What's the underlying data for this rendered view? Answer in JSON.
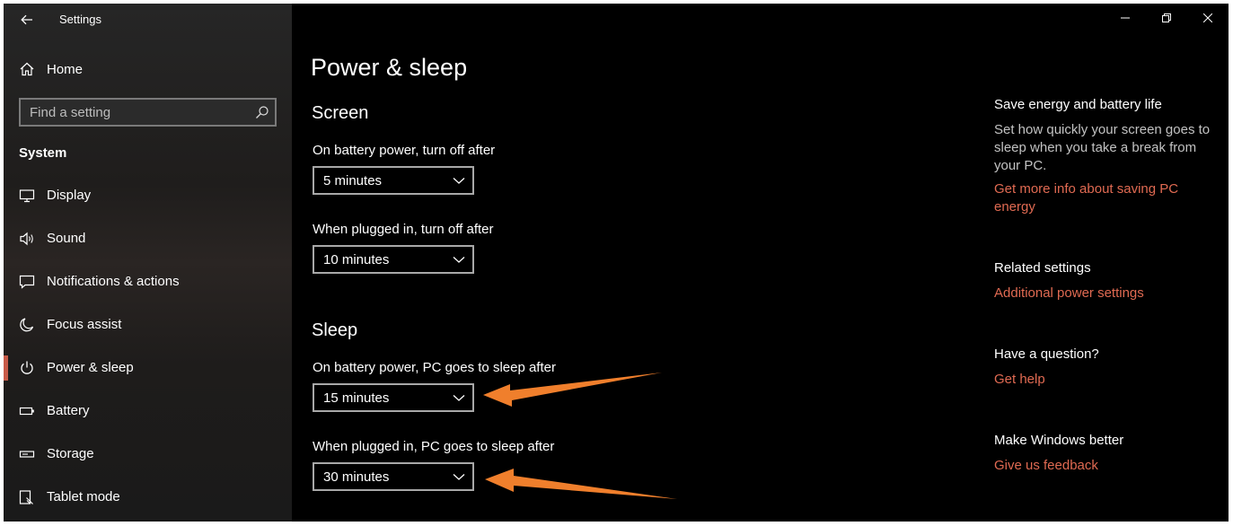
{
  "app": {
    "title": "Settings"
  },
  "sidebar": {
    "home_label": "Home",
    "search_placeholder": "Find a setting",
    "section_title": "System",
    "items": [
      {
        "label": "Display",
        "icon": "monitor-icon"
      },
      {
        "label": "Sound",
        "icon": "speaker-icon"
      },
      {
        "label": "Notifications & actions",
        "icon": "notification-icon"
      },
      {
        "label": "Focus assist",
        "icon": "moon-icon"
      },
      {
        "label": "Power & sleep",
        "icon": "power-icon",
        "active": true
      },
      {
        "label": "Battery",
        "icon": "battery-icon"
      },
      {
        "label": "Storage",
        "icon": "storage-icon"
      },
      {
        "label": "Tablet mode",
        "icon": "tablet-mode-icon"
      }
    ]
  },
  "main": {
    "title": "Power & sleep",
    "screen": {
      "title": "Screen",
      "battery_label": "On battery power, turn off after",
      "battery_value": "5 minutes",
      "plugged_label": "When plugged in, turn off after",
      "plugged_value": "10 minutes"
    },
    "sleep": {
      "title": "Sleep",
      "battery_label": "On battery power, PC goes to sleep after",
      "battery_value": "15 minutes",
      "plugged_label": "When plugged in, PC goes to sleep after",
      "plugged_value": "30 minutes"
    }
  },
  "right_panel": {
    "save_energy": {
      "title": "Save energy and battery life",
      "text": "Set how quickly your screen goes to sleep when you take a break from your PC.",
      "link": "Get more info about saving PC energy"
    },
    "related": {
      "title": "Related settings",
      "link": "Additional power settings"
    },
    "question": {
      "title": "Have a question?",
      "link": "Get help"
    },
    "better": {
      "title": "Make Windows better",
      "link": "Give us feedback"
    }
  },
  "colors": {
    "accent_link": "#e06a52",
    "annotation_arrow": "#f07f2c",
    "background": "#000000"
  }
}
